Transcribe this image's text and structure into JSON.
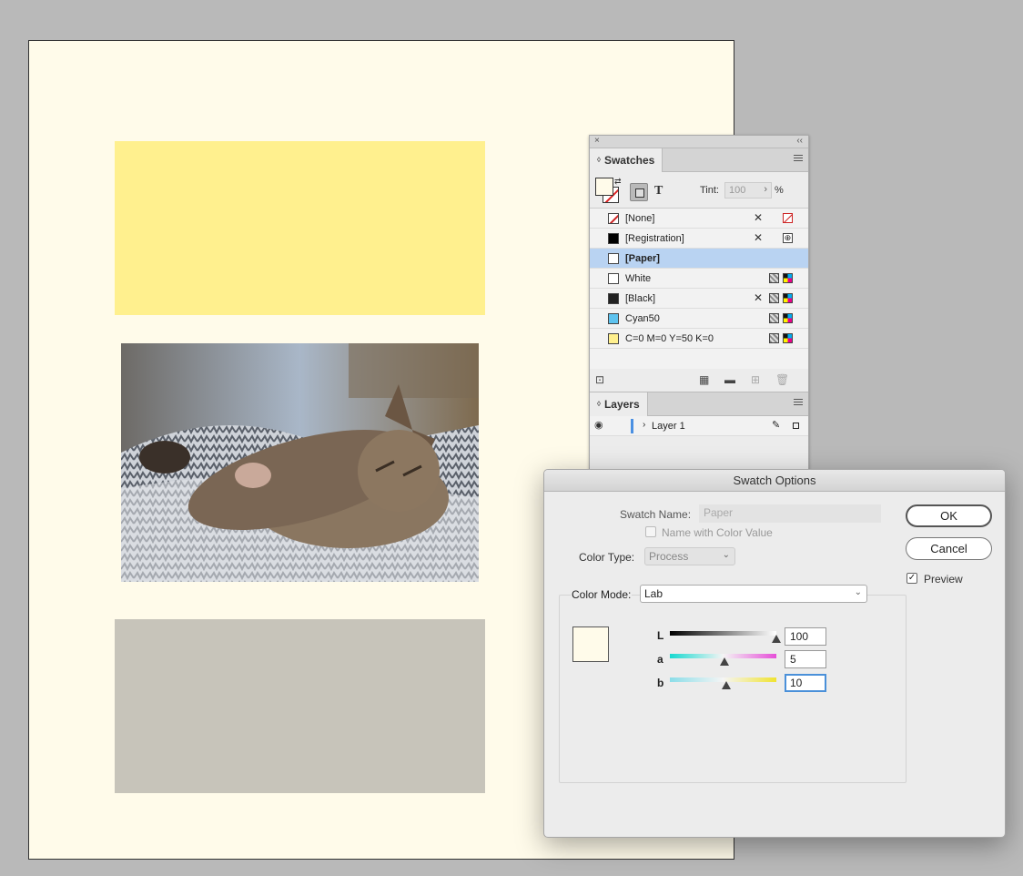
{
  "colors": {
    "paper": "#fffbea",
    "yellow_frame": "#fff08e",
    "gray_frame": "#c7c4ba",
    "selection": "#b9d3f2",
    "accent": "#4a90d9"
  },
  "document": {
    "photo_description_icon": "kitten-photo"
  },
  "swatches_panel": {
    "close_glyph": "×",
    "collapse_glyph": "‹‹",
    "tab_label": "Swatches",
    "tab_arrow": "◊",
    "text_button": "T",
    "tint_label": "Tint:",
    "tint_value": "100",
    "tint_arrow": "›",
    "tint_unit": "%",
    "items": [
      {
        "name": "[None]",
        "chip": "none",
        "color": "#ffffff",
        "noedit": true,
        "mode": "none"
      },
      {
        "name": "[Registration]",
        "chip": "solid",
        "color": "#000000",
        "noedit": true,
        "mode": "registration"
      },
      {
        "name": "[Paper]",
        "chip": "solid",
        "color": "#ffffff",
        "noedit": false,
        "mode": "",
        "selected": true
      },
      {
        "name": "White",
        "chip": "solid",
        "color": "#ffffff",
        "noedit": false,
        "mode": "cmyk"
      },
      {
        "name": "[Black]",
        "chip": "solid",
        "color": "#222222",
        "noedit": true,
        "mode": "cmyk"
      },
      {
        "name": "Cyan50",
        "chip": "solid",
        "color": "#5ec3ef",
        "noedit": false,
        "mode": "cmyk"
      },
      {
        "name": "C=0 M=0 Y=50 K=0",
        "chip": "solid",
        "color": "#fff08e",
        "noedit": false,
        "mode": "cmyk"
      }
    ]
  },
  "layers_panel": {
    "tab_label": "Layers",
    "tab_arrow": "◊",
    "layer_name": "Layer 1",
    "chevron": "›"
  },
  "dialog": {
    "title": "Swatch Options",
    "swatch_name_label": "Swatch Name:",
    "swatch_name_value": "Paper",
    "name_with_color_value_label": "Name with Color Value",
    "color_type_label": "Color Type:",
    "color_type_value": "Process",
    "ok_label": "OK",
    "cancel_label": "Cancel",
    "preview_label": "Preview",
    "preview_checked": true,
    "color_mode_label": "Color Mode:",
    "color_mode_value": "Lab",
    "sliders": [
      {
        "label": "L",
        "value": "100",
        "fraction": 1.0
      },
      {
        "label": "a",
        "value": "5",
        "fraction": 0.51
      },
      {
        "label": "b",
        "value": "10",
        "fraction": 0.53
      }
    ]
  }
}
